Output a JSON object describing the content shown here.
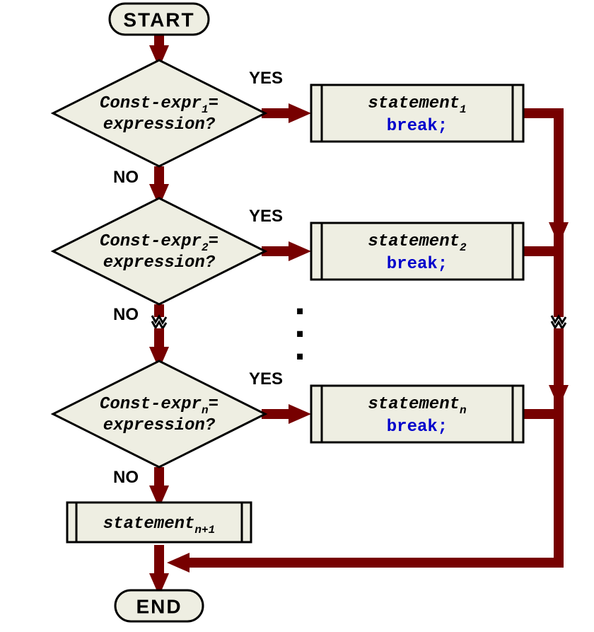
{
  "terminals": {
    "start": "START",
    "end": "END"
  },
  "labels": {
    "yes": "YES",
    "no": "NO"
  },
  "decisions": [
    {
      "line1_pre": "Const-expr",
      "sub": "1",
      "line1_post": "=",
      "line2": "expression",
      "q": "?"
    },
    {
      "line1_pre": "Const-expr",
      "sub": "2",
      "line1_post": "=",
      "line2": "expression",
      "q": "?"
    },
    {
      "line1_pre": "Const-expr",
      "sub": "n",
      "line1_post": "=",
      "line2": "expression",
      "q": "?"
    }
  ],
  "processes": [
    {
      "stmt": "statement",
      "sub": "1",
      "brk": "break;"
    },
    {
      "stmt": "statement",
      "sub": "2",
      "brk": "break;"
    },
    {
      "stmt": "statement",
      "sub": "n",
      "brk": "break;"
    }
  ],
  "default_process": {
    "stmt": "statement",
    "sub": "n+1"
  },
  "ellipsis": {
    "a": ".",
    "b": ".",
    "c": "."
  }
}
